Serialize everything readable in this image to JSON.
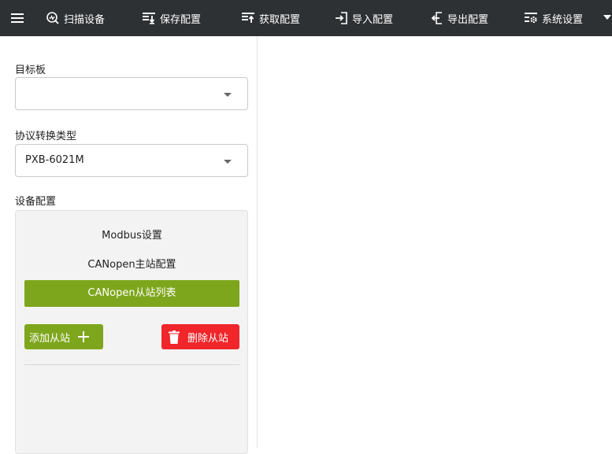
{
  "toolbar": {
    "menu_icon": "hamburger-menu-icon",
    "items": [
      {
        "label": "扫描设备",
        "icon": "scan-icon"
      },
      {
        "label": "保存配置",
        "icon": "save-config-icon"
      },
      {
        "label": "获取配置",
        "icon": "fetch-config-icon"
      },
      {
        "label": "导入配置",
        "icon": "import-icon"
      },
      {
        "label": "导出配置",
        "icon": "export-icon"
      },
      {
        "label": "系统设置",
        "icon": "system-settings-icon"
      }
    ]
  },
  "left_panel": {
    "target_board": {
      "label": "目标板",
      "value": ""
    },
    "protocol_type": {
      "label": "协议转换类型",
      "value": "PXB-6021M"
    },
    "device_config": {
      "label": "设备配置",
      "items": [
        {
          "label": "Modbus设置",
          "active": false
        },
        {
          "label": "CANopen主站配置",
          "active": false
        },
        {
          "label": "CANopen从站列表",
          "active": true
        }
      ],
      "add_button": "添加从站",
      "delete_button": "删除从站"
    }
  },
  "colors": {
    "toolbar_bg": "#2e3134",
    "accent_green": "#7ea61c",
    "danger_red": "#f0262b"
  }
}
